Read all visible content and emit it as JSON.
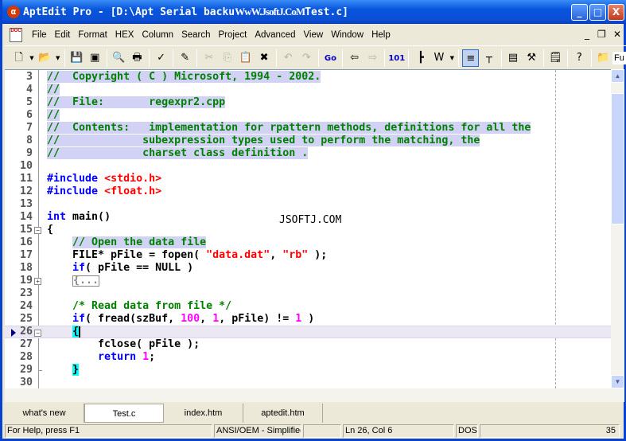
{
  "window": {
    "title": "AptEdit Pro - [D:\\Apt Serial backu",
    "title_watermark": "WwW.JsoftJ.CoM",
    "title_suffix": "Test.c]",
    "minimize": "_",
    "maximize": "□",
    "close": "X"
  },
  "menu": [
    "File",
    "Edit",
    "Format",
    "HEX",
    "Column",
    "Search",
    "Project",
    "Advanced",
    "View",
    "Window",
    "Help"
  ],
  "mdi": {
    "minimize": "_",
    "restore": "❐",
    "close": "✕"
  },
  "toolbar": {
    "items": [
      {
        "name": "new-icon",
        "g": "🗋",
        "dd": true
      },
      {
        "name": "open-icon",
        "g": "📂",
        "dd": true
      },
      "sep",
      {
        "name": "save-icon",
        "g": "💾",
        "dis": true
      },
      {
        "name": "save-all-icon",
        "g": "▣"
      },
      "sep",
      {
        "name": "print-preview-icon",
        "g": "🔍"
      },
      {
        "name": "print-icon",
        "g": "🖶"
      },
      "sep",
      {
        "name": "spell-check-icon",
        "g": "✓"
      },
      "sep",
      {
        "name": "read-only-icon",
        "g": "✎"
      },
      "sep",
      {
        "name": "cut-icon",
        "g": "✂",
        "dis": true
      },
      {
        "name": "copy-icon",
        "g": "⎘",
        "dis": true
      },
      {
        "name": "paste-icon",
        "g": "📋",
        "dis": true
      },
      {
        "name": "delete-icon",
        "g": "✖"
      },
      "sep",
      {
        "name": "undo-icon",
        "g": "↶",
        "dis": true
      },
      {
        "name": "redo-icon",
        "g": "↷",
        "dis": true
      },
      "sep",
      {
        "name": "goto-icon",
        "g": "Go"
      },
      "sep",
      {
        "name": "prev-icon",
        "g": "⇦"
      },
      {
        "name": "next-icon",
        "g": "⇨",
        "dis": true
      },
      "sep",
      {
        "name": "hex-icon",
        "g": "101"
      },
      "sep",
      {
        "name": "indent-icon",
        "g": "┣"
      },
      {
        "name": "word-wrap-icon",
        "g": "W",
        "dd": true
      },
      "sep",
      {
        "name": "line-numbers-icon",
        "g": "≡",
        "on": true
      },
      {
        "name": "ruler-icon",
        "g": "┬"
      },
      "sep",
      {
        "name": "window-icon",
        "g": "▤"
      },
      {
        "name": "tools-icon",
        "g": "⚒"
      },
      "sep",
      {
        "name": "properties-icon",
        "g": "🗒"
      },
      "sep",
      {
        "name": "help-icon",
        "g": "?"
      },
      "sep",
      {
        "name": "function-icon",
        "g": "📁"
      }
    ],
    "function_label": "Fu"
  },
  "editor": {
    "watermark": "JSOFTJ.COM",
    "current_line": 26,
    "lines": [
      {
        "n": 3,
        "seg": [
          [
            "cm sel",
            "//  Copyright ( C ) Microsoft, 1994 - 2002."
          ]
        ]
      },
      {
        "n": 4,
        "seg": [
          [
            "cm sel",
            "//"
          ]
        ]
      },
      {
        "n": 5,
        "seg": [
          [
            "cm sel",
            "//  File:       regexpr2.cpp"
          ]
        ]
      },
      {
        "n": 6,
        "seg": [
          [
            "cm sel",
            "//"
          ]
        ]
      },
      {
        "n": 7,
        "seg": [
          [
            "cm sel",
            "//  Contents:   implementation for rpattern methods, definitions for all the"
          ]
        ]
      },
      {
        "n": 8,
        "seg": [
          [
            "cm sel",
            "//             subexpression types used to perform the matching, the"
          ]
        ]
      },
      {
        "n": 9,
        "seg": [
          [
            "cm sel",
            "//             charset class definition ."
          ]
        ]
      },
      {
        "n": 10,
        "seg": []
      },
      {
        "n": 11,
        "seg": [
          [
            "kw",
            "#include "
          ],
          [
            "str",
            "<stdio.h>"
          ]
        ]
      },
      {
        "n": 12,
        "seg": [
          [
            "kw",
            "#include "
          ],
          [
            "str",
            "<float.h>"
          ]
        ]
      },
      {
        "n": 13,
        "seg": []
      },
      {
        "n": 14,
        "seg": [
          [
            "kw",
            "int"
          ],
          [
            "pl",
            " main()"
          ]
        ]
      },
      {
        "n": 15,
        "fold": "-",
        "seg": [
          [
            "pl",
            "{"
          ]
        ]
      },
      {
        "n": 16,
        "seg": [
          [
            "pl",
            "    "
          ],
          [
            "cm sel",
            "// Open the data file"
          ]
        ]
      },
      {
        "n": 17,
        "seg": [
          [
            "pl",
            "    FILE* pFile = fopen( "
          ],
          [
            "str",
            "\"data.dat\""
          ],
          [
            "pl",
            ", "
          ],
          [
            "str",
            "\"rb\""
          ],
          [
            "pl",
            " );"
          ]
        ]
      },
      {
        "n": 18,
        "seg": [
          [
            "pl",
            "    "
          ],
          [
            "kw",
            "if"
          ],
          [
            "pl",
            "( pFile == NULL )"
          ]
        ]
      },
      {
        "n": 19,
        "fold": "+",
        "seg": [
          [
            "pl",
            "    "
          ],
          [
            "collapsed",
            "{..."
          ]
        ]
      },
      {
        "n": 23,
        "seg": []
      },
      {
        "n": 24,
        "seg": [
          [
            "pl",
            "    "
          ],
          [
            "cm",
            "/* Read data from file */"
          ]
        ]
      },
      {
        "n": 25,
        "seg": [
          [
            "pl",
            "    "
          ],
          [
            "kw",
            "if"
          ],
          [
            "pl",
            "( fread(szBuf, "
          ],
          [
            "num",
            "100"
          ],
          [
            "pl",
            ", "
          ],
          [
            "num",
            "1"
          ],
          [
            "pl",
            ", pFile) != "
          ],
          [
            "num",
            "1"
          ],
          [
            "pl",
            " )"
          ]
        ]
      },
      {
        "n": 26,
        "fold": "-",
        "mark": true,
        "seg": [
          [
            "pl",
            "    "
          ],
          [
            "brace",
            "{"
          ],
          [
            "caret",
            ""
          ]
        ]
      },
      {
        "n": 27,
        "seg": [
          [
            "pl",
            "        fclose( pFile );"
          ]
        ]
      },
      {
        "n": 28,
        "seg": [
          [
            "pl",
            "        "
          ],
          [
            "kw",
            "return "
          ],
          [
            "num",
            "1"
          ],
          [
            "pl",
            ";"
          ]
        ]
      },
      {
        "n": 29,
        "end": true,
        "seg": [
          [
            "pl",
            "    "
          ],
          [
            "brace",
            "}"
          ]
        ]
      },
      {
        "n": 30,
        "seg": []
      }
    ]
  },
  "tabs": [
    {
      "label": "what's new"
    },
    {
      "label": "Test.c",
      "active": true
    },
    {
      "label": "index.htm"
    },
    {
      "label": "aptedit.htm"
    }
  ],
  "status": {
    "help": "For Help, press F1",
    "encoding": "ANSI/OEM - Simplified Chinese (GB",
    "empty": "",
    "position": "Ln 26, Col 6",
    "format": "DOS",
    "count": "35"
  }
}
